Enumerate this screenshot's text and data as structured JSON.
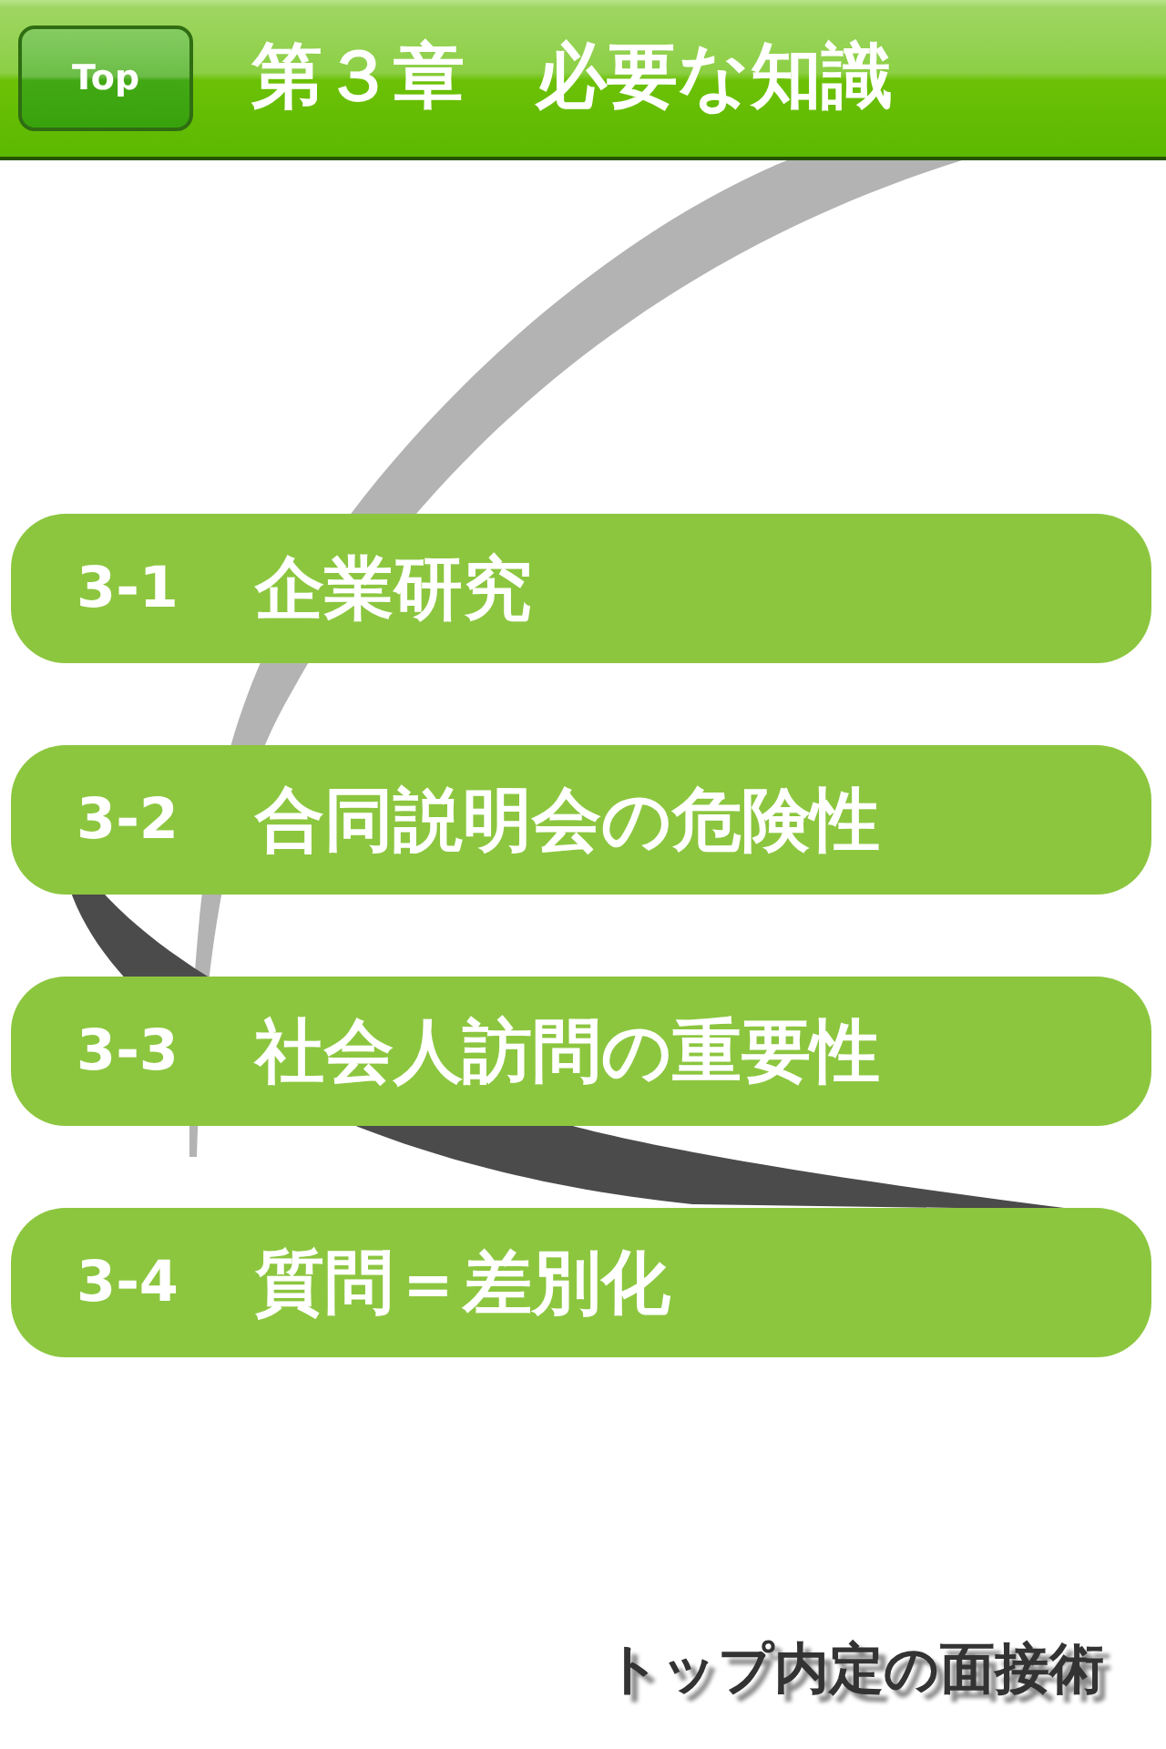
{
  "header": {
    "top_button": "Top",
    "title": "第３章　必要な知識"
  },
  "menu": [
    {
      "number": "3-1",
      "title": "企業研究"
    },
    {
      "number": "3-2",
      "title": "合同説明会の危険性"
    },
    {
      "number": "3-3",
      "title": "社会人訪問の重要性"
    },
    {
      "number": "3-4",
      "title": "質問＝差別化"
    }
  ],
  "footer": {
    "logo": "トップ内定の面接術"
  }
}
